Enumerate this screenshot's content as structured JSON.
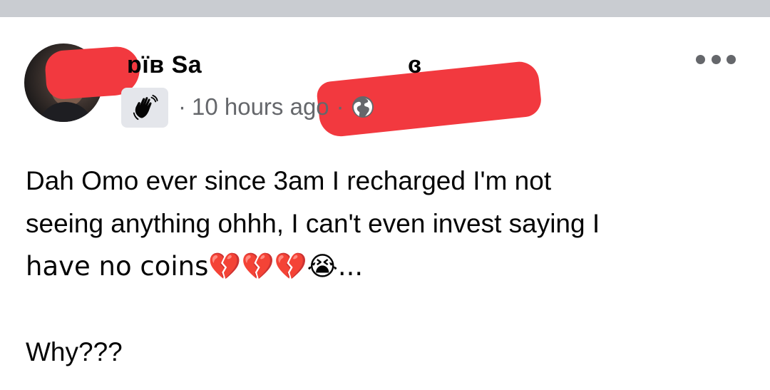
{
  "post": {
    "author_name_visible_start": "ɒïʙ Sa",
    "author_name_visible_end": "ɞ",
    "time_ago": "10 hours ago",
    "separator": "·",
    "privacy_icon": "globe-icon",
    "badge_icon": "waving-hand-icon",
    "more_icon": "more-options-icon",
    "body_lines": [
      "Dah Omo ever since 3am I recharged I'm not",
      "seeing anything ohhh, I can't even invest saying I",
      "have no coins💔💔💔😭..."
    ],
    "body_followup": "Why???"
  },
  "colors": {
    "top_band": "#c9ccd1",
    "redaction": "#f2393f",
    "meta_text": "#65676b",
    "body_text": "#050505",
    "badge_bg": "#e4e6eb"
  }
}
